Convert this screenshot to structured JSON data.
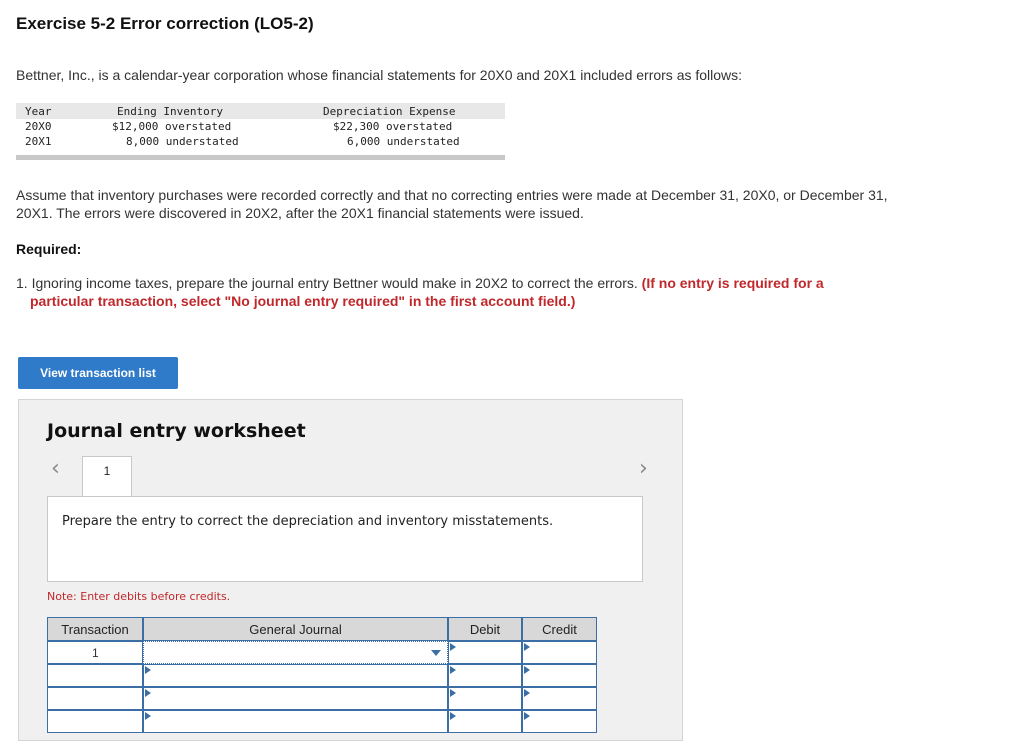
{
  "title": "Exercise 5-2 Error correction (LO5-2)",
  "intro": "Bettner, Inc., is a calendar-year corporation whose financial statements for 20X0 and 20X1 included errors as follows:",
  "errors_table": {
    "headers": {
      "year": "Year",
      "inventory": "Ending Inventory",
      "depreciation": "Depreciation Expense"
    },
    "rows": [
      {
        "year": "20X0",
        "inventory": "$12,000 overstated",
        "depreciation": "$22,300 overstated"
      },
      {
        "year": "20X1",
        "inventory": "8,000 understated",
        "depreciation": "6,000 understated"
      }
    ]
  },
  "assumption_text": "Assume that inventory purchases were recorded correctly and that no correcting entries were made at December 31, 20X0, or December 31, 20X1. The errors were discovered in 20X2, after the 20X1 financial statements were issued.",
  "required_label": "Required:",
  "question": {
    "text": "1. Ignoring income taxes, prepare the journal entry Bettner would make in 20X2 to correct the errors.",
    "instruction_line1": "(If no entry is required for a",
    "instruction_line2": "particular transaction, select \"No journal entry required\" in the first account field.)"
  },
  "view_button_label": "View transaction list",
  "worksheet": {
    "title": "Journal entry worksheet",
    "tab_label": "1",
    "prompt": "Prepare the entry to correct the depreciation and inventory misstatements.",
    "note": "Note: Enter debits before credits.",
    "columns": {
      "transaction": "Transaction",
      "journal": "General Journal",
      "debit": "Debit",
      "credit": "Credit"
    },
    "first_transaction": "1"
  },
  "icons": {
    "prev": "chevron-left-icon",
    "next": "chevron-right-icon",
    "dropdown": "dropdown-arrow-icon"
  },
  "colors": {
    "accent": "#2f7ac9",
    "instruction_red": "#c0282b",
    "grid_blue": "#3a6ea5"
  }
}
